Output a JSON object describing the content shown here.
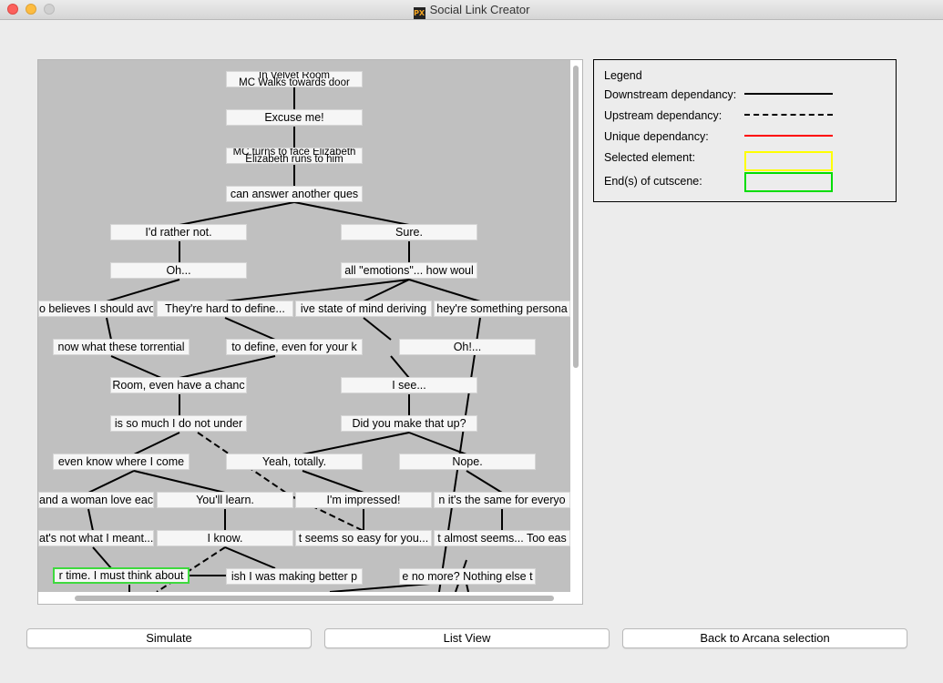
{
  "window": {
    "title": "Social Link Creator",
    "app_icon": "PX"
  },
  "graph": {
    "nodes": [
      {
        "text": "In Velvet Room",
        "text2": "MC Walks towards door"
      },
      {
        "text": "Excuse me!"
      },
      {
        "text": "MC turns to face Elizabeth",
        "text2": "Elizabeth runs to him"
      },
      {
        "text": "can answer another ques"
      },
      {
        "text": "I'd rather not."
      },
      {
        "text": "Sure."
      },
      {
        "text": "Oh..."
      },
      {
        "text": "all \"emotions\"... how woul"
      },
      {
        "text": "o believes I should avo"
      },
      {
        "text": "They're hard to define..."
      },
      {
        "text": "ive state of mind deriving"
      },
      {
        "text": "hey're something persona"
      },
      {
        "text": "now what these torrential"
      },
      {
        "text": "to define, even for your k"
      },
      {
        "text": "Oh!..."
      },
      {
        "text": "Room, even have a chanc"
      },
      {
        "text": "I see..."
      },
      {
        "text": "is so much I do not under"
      },
      {
        "text": "Did you make that up?"
      },
      {
        "text": "even know where I come"
      },
      {
        "text": "Yeah, totally."
      },
      {
        "text": "Nope."
      },
      {
        "text": "and a woman love eac"
      },
      {
        "text": "You'll learn."
      },
      {
        "text": "I'm impressed!"
      },
      {
        "text": "n it's the same for everyo"
      },
      {
        "text": "at's not what I meant..."
      },
      {
        "text": "I know."
      },
      {
        "text": "t seems so easy for you..."
      },
      {
        "text": "t almost seems... Too eas"
      },
      {
        "text": "r time. I must think about"
      },
      {
        "text": "ish I was making better p"
      },
      {
        "text": "e no more? Nothing else t"
      }
    ]
  },
  "legend": {
    "title": "Legend",
    "items": [
      {
        "label": "Downstream dependancy:"
      },
      {
        "label": "Upstream dependancy:"
      },
      {
        "label": "Unique dependancy:"
      },
      {
        "label": "Selected element:"
      },
      {
        "label": "End(s) of cutscene:"
      }
    ],
    "colors": {
      "unique": "#ff0000",
      "selected": "#ffff00",
      "end": "#00dd00"
    }
  },
  "buttons": {
    "simulate": "Simulate",
    "list_view": "List View",
    "back": "Back to Arcana selection"
  }
}
